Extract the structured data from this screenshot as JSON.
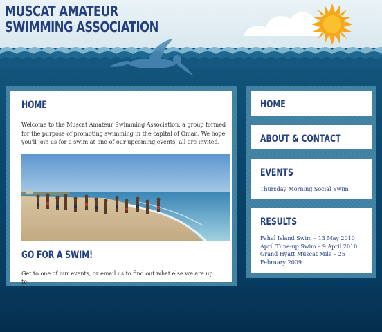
{
  "header": {
    "title_line1": "MUSCAT AMATEUR",
    "title_line2": "SWIMMING ASSOCIATION"
  },
  "main": {
    "heading": "HOME",
    "intro": "Welcome to the Muscat Amateur Swimming Association, a group formed for the purpose of promoting swimming in the capital of Oman. We hope you'll join us for a swim at one of our upcoming events; all are invited.",
    "section_heading": "GO FOR A SWIM!",
    "outro": "Get to one of our events, or email us to find out what else we are up to."
  },
  "sidebar": {
    "home": "HOME",
    "about": "ABOUT & CONTACT",
    "events": {
      "heading": "EVENTS",
      "items": [
        "Thursday Morning Social Swim"
      ]
    },
    "results": {
      "heading": "RESULTS",
      "items": [
        "Fahal Island Swim – 13 May 2010",
        "April Tune-up Swim – 9 April 2010",
        "Grand Hyatt Muscat Mile – 25 February 2009"
      ]
    }
  },
  "colors": {
    "heading": "#233f7d",
    "sea": "#0c4a70",
    "frame": "#3d7ea0",
    "sun": "#f6a81c"
  },
  "icons": [
    "cloud-icon",
    "sun-icon",
    "swimmer-icon"
  ]
}
